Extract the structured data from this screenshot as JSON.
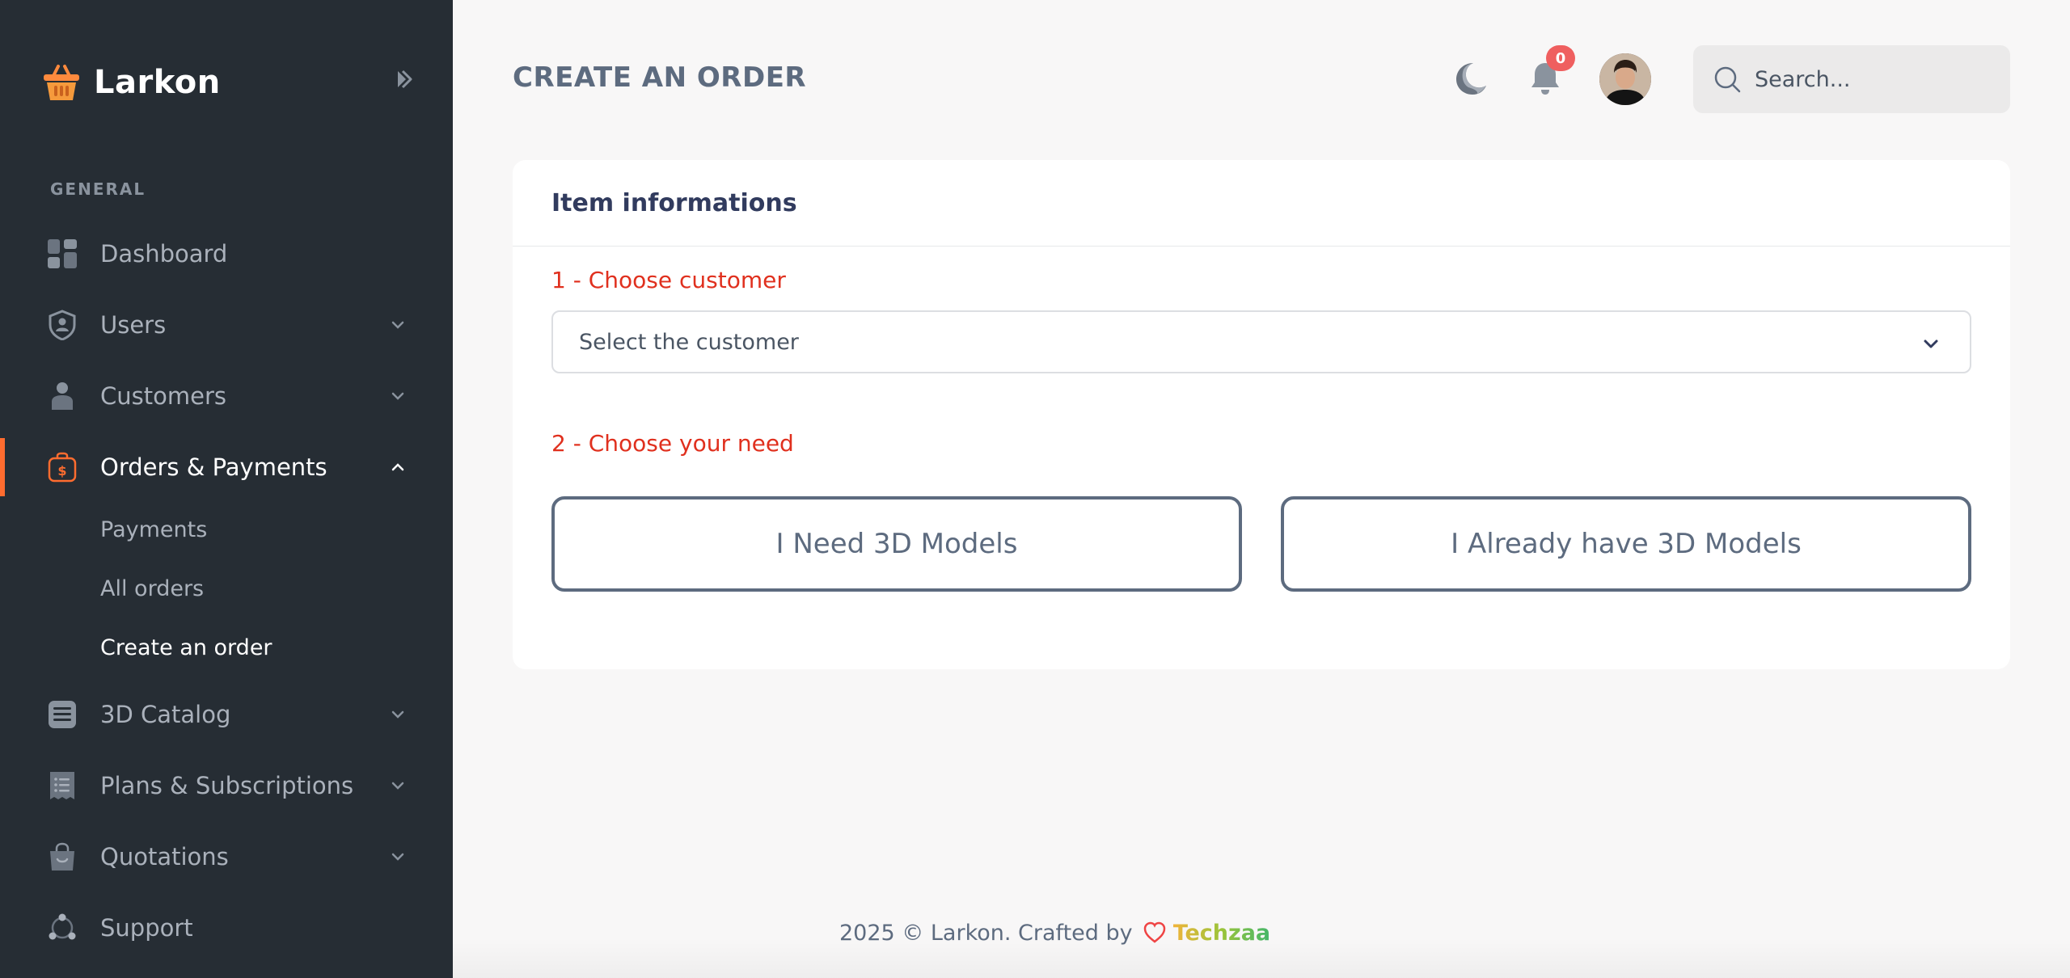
{
  "app": {
    "name": "Larkon",
    "accent_color": "#ff6c2f",
    "sidebar_bg": "#262d34"
  },
  "sidebar": {
    "section_label": "GENERAL",
    "items": [
      {
        "label": "Dashboard",
        "icon": "dashboard-icon"
      },
      {
        "label": "Users",
        "icon": "shield-user-icon"
      },
      {
        "label": "Customers",
        "icon": "person-icon"
      },
      {
        "label": "Orders & Payments",
        "icon": "bag-dollar-icon",
        "active": true
      },
      {
        "label": "3D Catalog",
        "icon": "catalog-icon"
      },
      {
        "label": "Plans & Subscriptions",
        "icon": "receipt-icon"
      },
      {
        "label": "Quotations",
        "icon": "shopping-bag-icon"
      },
      {
        "label": "Support",
        "icon": "support-icon"
      }
    ],
    "sub_items": [
      {
        "label": "Payments"
      },
      {
        "label": "All orders"
      },
      {
        "label": "Create an order",
        "current": true
      }
    ]
  },
  "header": {
    "title": "CREATE AN ORDER",
    "notification_count": "0",
    "search_placeholder": "Search..."
  },
  "card": {
    "title": "Item informations",
    "step1_label": "1 - Choose customer",
    "select_placeholder": "Select the customer",
    "step2_label": "2 - Choose your need",
    "option_a": "I Need 3D Models",
    "option_b": "I Already have 3D Models"
  },
  "footer": {
    "text": "2025 © Larkon. Crafted by",
    "brand": "Techzaa"
  }
}
